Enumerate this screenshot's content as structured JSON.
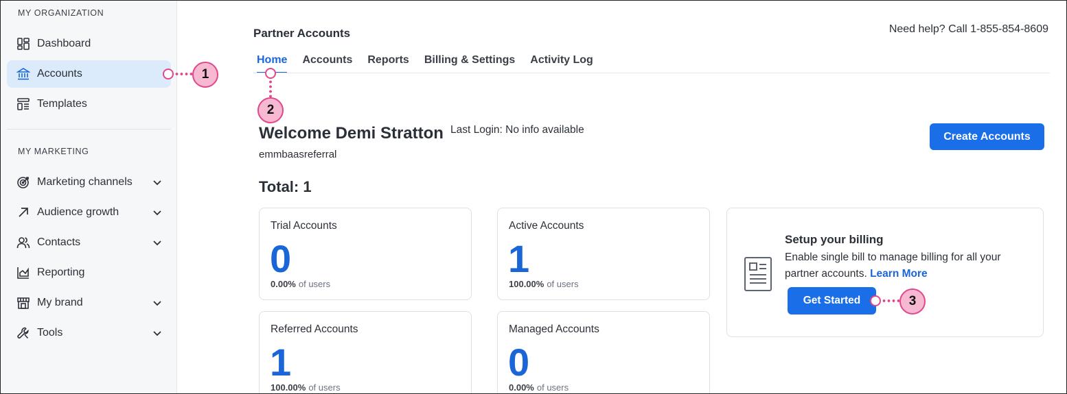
{
  "sidebar": {
    "org_heading": "MY ORGANIZATION",
    "marketing_heading": "MY MARKETING",
    "org_items": [
      {
        "label": "Dashboard",
        "icon": "dashboard-icon"
      },
      {
        "label": "Accounts",
        "icon": "bank-icon",
        "active": true
      },
      {
        "label": "Templates",
        "icon": "templates-icon"
      }
    ],
    "marketing_items": [
      {
        "label": "Marketing channels",
        "icon": "target-icon",
        "expandable": true
      },
      {
        "label": "Audience growth",
        "icon": "arrow-up-right-icon",
        "expandable": true
      },
      {
        "label": "Contacts",
        "icon": "contacts-icon",
        "expandable": true
      },
      {
        "label": "Reporting",
        "icon": "reporting-chart-icon",
        "expandable": false
      },
      {
        "label": "My brand",
        "icon": "storefront-icon",
        "expandable": true
      },
      {
        "label": "Tools",
        "icon": "wrench-icon",
        "expandable": true
      }
    ]
  },
  "header": {
    "title": "Partner Accounts",
    "help": "Need help? Call 1-855-854-8609"
  },
  "tabs": [
    {
      "label": "Home",
      "active": true
    },
    {
      "label": "Accounts"
    },
    {
      "label": "Reports"
    },
    {
      "label": "Billing & Settings"
    },
    {
      "label": "Activity Log"
    }
  ],
  "welcome": {
    "greeting": "Welcome Demi Stratton",
    "last_login": "Last Login: No info available",
    "username": "emmbaasreferral",
    "create_button": "Create Accounts",
    "total": "Total: 1"
  },
  "cards": [
    {
      "title": "Trial Accounts",
      "count": "0",
      "percent": "0.00%",
      "suffix": "of users"
    },
    {
      "title": "Active Accounts",
      "count": "1",
      "percent": "100.00%",
      "suffix": "of users"
    },
    {
      "title": "Referred Accounts",
      "count": "1",
      "percent": "100.00%",
      "suffix": "of users"
    },
    {
      "title": "Managed Accounts",
      "count": "0",
      "percent": "0.00%",
      "suffix": "of users"
    }
  ],
  "billing": {
    "title": "Setup your billing",
    "description": "Enable single bill to manage billing for all your partner accounts.",
    "link": "Learn More",
    "button": "Get Started",
    "icon": "document-icon"
  },
  "callouts": [
    "1",
    "2",
    "3"
  ],
  "colors": {
    "accent": "#1a6ee8",
    "callout": "#e2468b",
    "callout_fill": "#f7b8d2"
  }
}
